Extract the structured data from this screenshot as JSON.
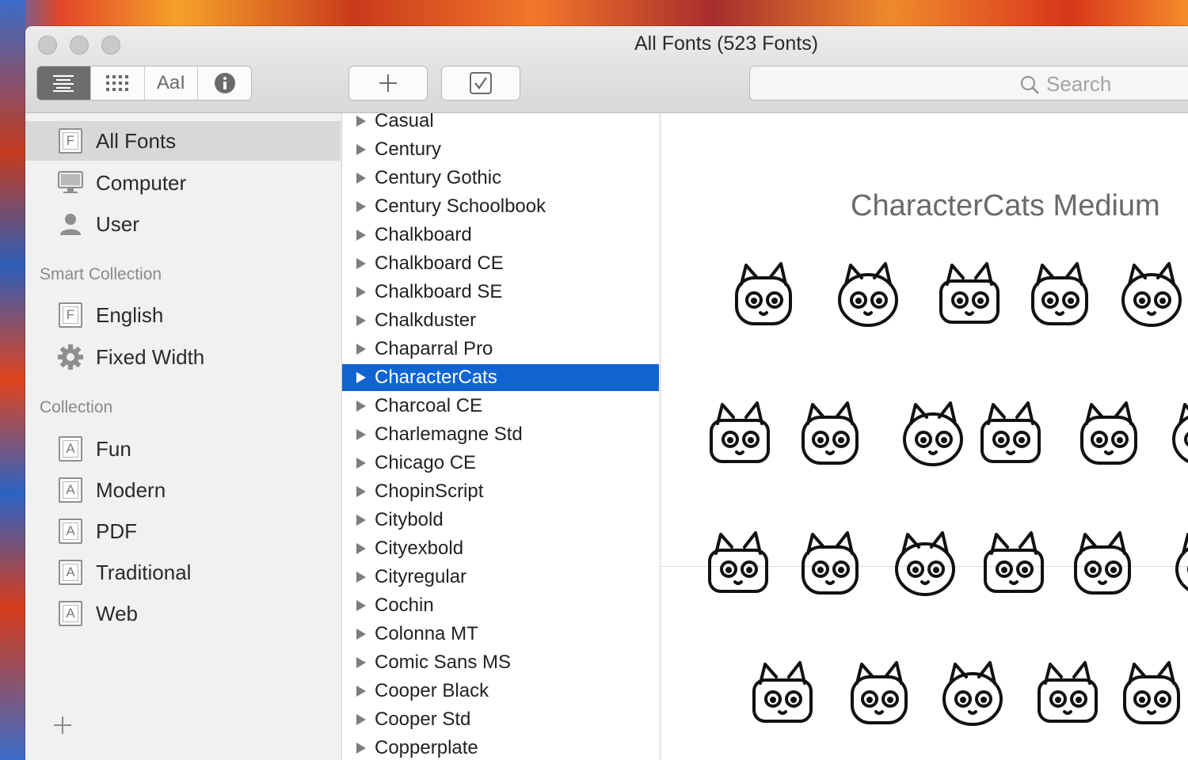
{
  "window": {
    "title": "All Fonts (523 Fonts)"
  },
  "toolbar": {
    "view_buttons": [
      {
        "name": "list-view-icon",
        "label": ""
      },
      {
        "name": "grid-view-icon",
        "label": ""
      },
      {
        "name": "sample-view-icon",
        "label": "AaI"
      },
      {
        "name": "info-icon",
        "label": ""
      }
    ],
    "add_button_icon": "plus-icon",
    "validate_button_icon": "checkbox-icon",
    "search": {
      "placeholder": "Search"
    }
  },
  "sidebar": {
    "library": [
      {
        "label": "All Fonts",
        "icon": "font-library-icon",
        "selected": true
      },
      {
        "label": "Computer",
        "icon": "computer-icon"
      },
      {
        "label": "User",
        "icon": "user-icon"
      }
    ],
    "smart_collection_header": "Smart Collection",
    "smart_collections": [
      {
        "label": "English",
        "icon": "font-library-icon"
      },
      {
        "label": "Fixed Width",
        "icon": "gear-icon"
      }
    ],
    "collection_header": "Collection",
    "collections": [
      {
        "label": "Fun",
        "icon": "collection-icon"
      },
      {
        "label": "Modern",
        "icon": "collection-icon"
      },
      {
        "label": "PDF",
        "icon": "collection-icon"
      },
      {
        "label": "Traditional",
        "icon": "collection-icon"
      },
      {
        "label": "Web",
        "icon": "collection-icon"
      }
    ],
    "add_collection_icon": "plus-icon"
  },
  "font_list": {
    "selected_index": 9,
    "items": [
      "Casual",
      "Century",
      "Century Gothic",
      "Century Schoolbook",
      "Chalkboard",
      "Chalkboard CE",
      "Chalkboard SE",
      "Chalkduster",
      "Chaparral Pro",
      "CharacterCats",
      "Charcoal CE",
      "Charlemagne Std",
      "Chicago CE",
      "ChopinScript",
      "Citybold",
      "Cityexbold",
      "Cityregular",
      "Cochin",
      "Colonna MT",
      "Comic Sans MS",
      "Cooper Black",
      "Cooper Std",
      "Copperplate"
    ]
  },
  "preview": {
    "title": "CharacterCats Medium",
    "glyph_icon": "cat-face-glyph-icon"
  },
  "colors": {
    "selection_blue": "#0f64d2",
    "toolbar_active": "#6d6d6d"
  }
}
